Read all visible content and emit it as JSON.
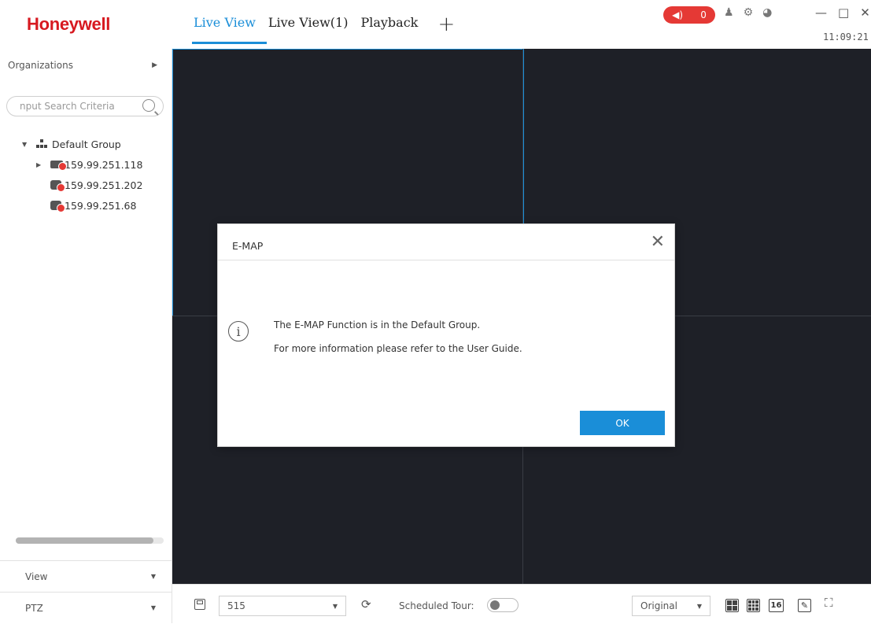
{
  "app": {
    "brand": "Honeywell",
    "clock": "11:09:21",
    "alarm_count": "0"
  },
  "tabs": [
    {
      "label": "Live View",
      "active": true
    },
    {
      "label": "Live View(1)",
      "active": false
    },
    {
      "label": "Playback",
      "active": false
    }
  ],
  "tab_add": "+",
  "sidebar": {
    "organizations": "Organizations",
    "search_placeholder": "nput Search Criteria",
    "tree": {
      "group": "Default Group",
      "devices": [
        "159.99.251.118",
        "159.99.251.202",
        "159.99.251.68"
      ]
    },
    "view_label": "View",
    "ptz_label": "PTZ"
  },
  "toolbar": {
    "view_select": "515",
    "scheduled_tour_label": "Scheduled Tour:",
    "stream_select": "Original",
    "layout_16": "16"
  },
  "dialog": {
    "title": "E-MAP",
    "line1": "The E-MAP Function is in the Default Group.",
    "line2": "For more information please refer to the User Guide.",
    "ok_label": "OK"
  },
  "colors": {
    "brand": "#d71920",
    "accent": "#1a8ed8",
    "alarm": "#e53935",
    "video_bg": "#1e2027"
  }
}
